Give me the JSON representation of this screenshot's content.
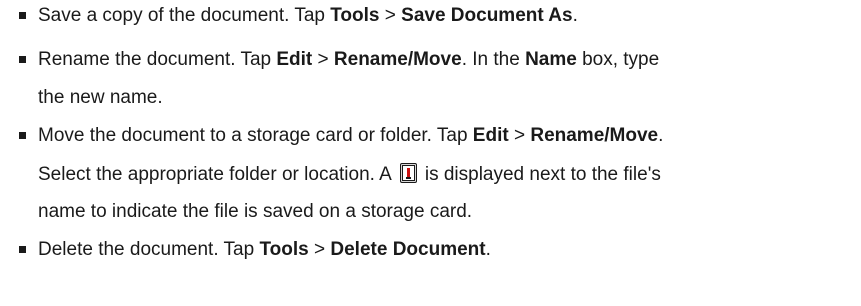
{
  "items": [
    {
      "line1": {
        "t1": "Save a copy of the document. Tap ",
        "b1": "Tools",
        "t2": " > ",
        "b2": "Save Document As",
        "t3": "."
      }
    },
    {
      "line1": {
        "t1": "Rename the document. Tap ",
        "b1": "Edit",
        "t2": " > ",
        "b2": "Rename/Move",
        "t3": ". In the ",
        "b3": "Name",
        "t4": " box, type"
      },
      "line2": "the new name."
    },
    {
      "line1": {
        "t1": "Move the document to a storage card or folder. Tap ",
        "b1": "Edit",
        "t2": " > ",
        "b2": "Rename/Move",
        "t3": "."
      },
      "line2": {
        "t1": "Select the appropriate folder or location. A",
        "icon": "storage-card-icon",
        "t2": "is displayed next to the file's"
      },
      "line3": "name to indicate the file is saved on a storage card."
    },
    {
      "line1": {
        "t1": "Delete the document. Tap ",
        "b1": "Tools",
        "t2": " > ",
        "b2": "Delete Document",
        "t3": "."
      }
    }
  ],
  "colors": {
    "text": "#1a1a1a",
    "icon_frame": "#1a1a1a",
    "icon_light": "#cc1111"
  }
}
